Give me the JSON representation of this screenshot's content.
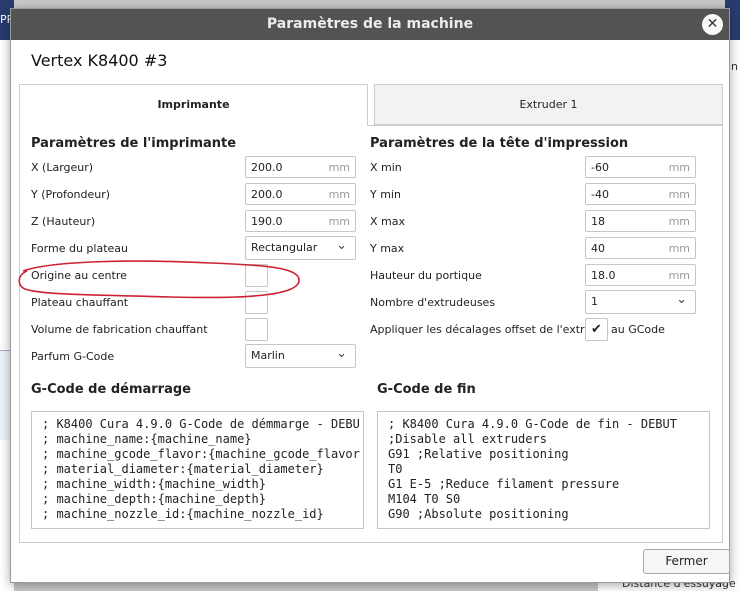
{
  "background": {
    "left_fragment": "PR",
    "right_fragment": "n t",
    "bottom_fragment": "Distance d'essuyage par"
  },
  "dialog": {
    "title": "Paramètres de la machine",
    "close_glyph": "✕",
    "machine_name": "Vertex K8400 #3",
    "tabs": [
      "Imprimante",
      "Extruder 1"
    ],
    "printer_settings": {
      "title": "Paramètres de l'imprimante",
      "x_label": "X (Largeur)",
      "x_value": "200.0",
      "y_label": "Y (Profondeur)",
      "y_value": "200.0",
      "z_label": "Z (Hauteur)",
      "z_value": "190.0",
      "unit": "mm",
      "plate_label": "Forme du plateau",
      "plate_value": "Rectangular",
      "origin_label": "Origine au centre",
      "heated_bed_label": "Plateau chauffant",
      "heated_volume_label": "Volume de fabrication chauffant",
      "gcode_flavor_label": "Parfum G-Code",
      "gcode_flavor_value": "Marlin"
    },
    "head_settings": {
      "title": "Paramètres de la tête d'impression",
      "xmin_label": "X min",
      "xmin_value": "-60",
      "ymin_label": "Y min",
      "ymin_value": "-40",
      "xmax_label": "X max",
      "xmax_value": "18",
      "ymax_label": "Y max",
      "ymax_value": "40",
      "gantry_label": "Hauteur du portique",
      "gantry_value": "18.0",
      "extruders_label": "Nombre d'extrudeuses",
      "extruders_value": "1",
      "offset_label_part1": "Appliquer les décalages offset de l'extrude",
      "offset_label_part2": "au GCode"
    },
    "start_gcode": {
      "title": "G-Code de démarrage",
      "text": "; K8400 Cura 4.9.0 G-Code de démmarge - DEBU\n; machine_name:{machine_name}\n; machine_gcode_flavor:{machine_gcode_flavor\n; material_diameter:{material_diameter}\n; machine_width:{machine_width}\n; machine_depth:{machine_depth}\n; machine_nozzle_id:{machine_nozzle_id}"
    },
    "end_gcode": {
      "title": "G-Code de fin",
      "text": "; K8400 Cura 4.9.0 G-Code de fin - DEBUT\n;Disable all extruders\nG91 ;Relative positioning\nT0\nG1 E-5 ;Reduce filament pressure\nM104 T0 S0\nG90 ;Absolute positioning"
    },
    "close_button": "Fermer"
  },
  "colors": {
    "titlebar": "#535353",
    "annotation": "#cc2233"
  }
}
